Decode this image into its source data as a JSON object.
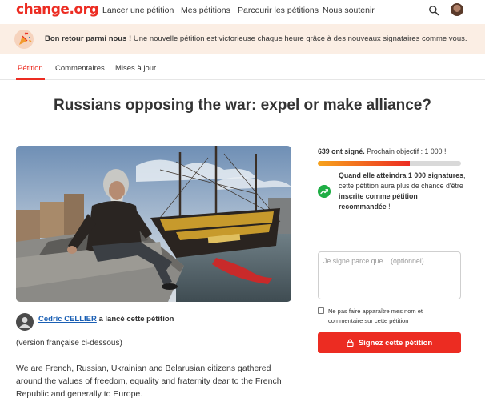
{
  "header": {
    "logo": "change.org",
    "nav": [
      "Lancer une pétition",
      "Mes pétitions",
      "Parcourir les pétitions",
      "Nous soutenir"
    ]
  },
  "banner": {
    "bold": "Bon retour parmi nous !",
    "text": " Une nouvelle pétition est victorieuse chaque heure grâce à des nouveaux signataires comme vous."
  },
  "tabs": [
    "Pétition",
    "Commentaires",
    "Mises à jour"
  ],
  "petition": {
    "title": "Russians opposing the war: expel or make alliance?",
    "author_name": "Cedric CELLIER",
    "author_rest": " a lancé cette pétition",
    "intro": "(version française ci-dessous)",
    "body": "We are French, Russian, Ukrainian and Belarusian citizens gathered around the values of freedom, equality and fraternity dear to the French Republic and generally to Europe."
  },
  "signatures": {
    "count": "639 ont signé.",
    "goal": " Prochain objectif : 1 000 !",
    "progress": 0.64,
    "goal_bold": "Quand elle atteindra 1 000 signatures",
    "goal_mid": ", cette pétition aura plus de chance d'être ",
    "goal_bold2": "inscrite comme pétition recommandée",
    "goal_end": " !"
  },
  "form": {
    "placeholder": "Je signe parce que... (optionnel)",
    "checkbox_label": "Ne pas faire apparaître mes nom et commentaire sur cette pétition",
    "sign_button": "Signez cette pétition"
  },
  "colors": {
    "brand": "#ec2c22",
    "link": "#1a5fb4",
    "success": "#1fae45"
  },
  "icons": {
    "search": "search-icon",
    "trend": "trending-up-icon",
    "lock": "lock-icon",
    "banner": "celebration-icon"
  }
}
